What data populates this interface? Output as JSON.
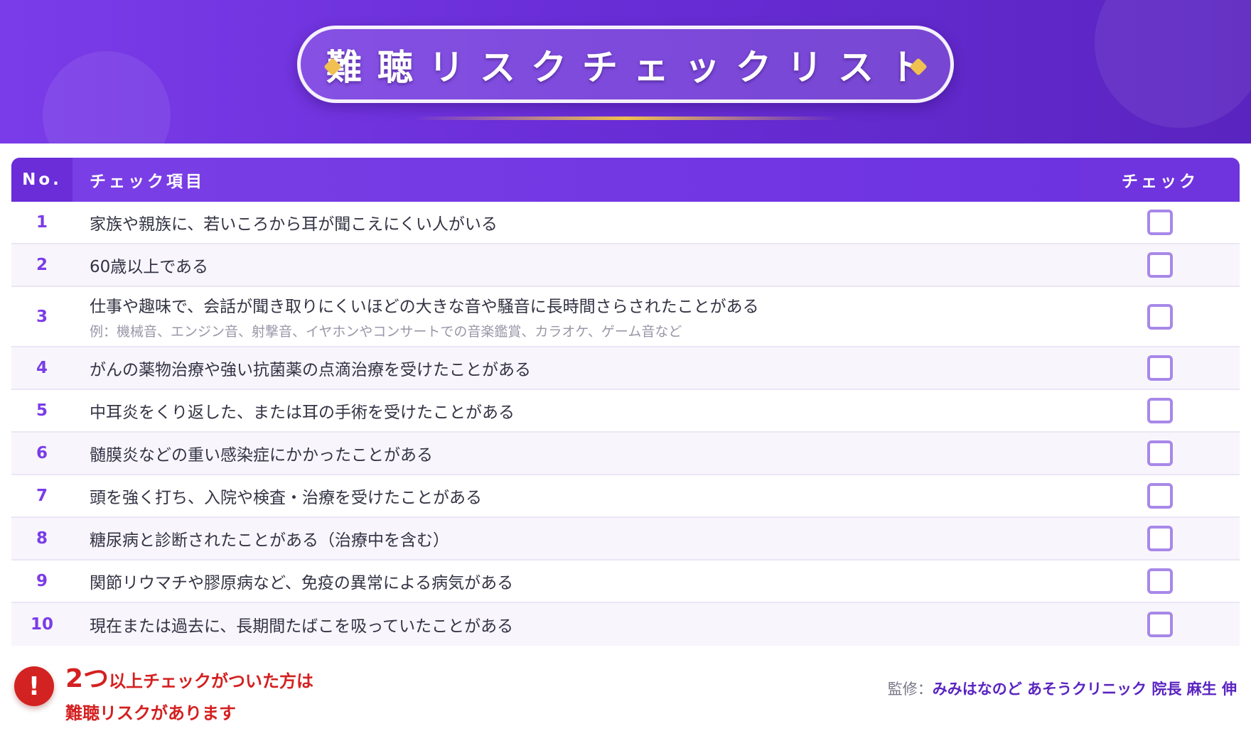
{
  "header": {
    "title": "難聴リスクチェックリスト"
  },
  "table": {
    "columns": {
      "no": "No.",
      "item": "チェック項目",
      "check": "チェック"
    },
    "rows": [
      {
        "no": "1",
        "text": "家族や親族に、若いころから耳が聞こえにくい人がいる",
        "checked": false
      },
      {
        "no": "2",
        "text": "60歳以上である",
        "checked": false
      },
      {
        "no": "3",
        "text": "仕事や趣味で、会話が聞き取りにくいほどの大きな音や騒音に長時間さらされたことがある",
        "note": "例：機械音、エンジン音、射撃音、イヤホンやコンサートでの音楽鑑賞、カラオケ、ゲーム音など",
        "checked": false
      },
      {
        "no": "4",
        "text": "がんの薬物治療や強い抗菌薬の点滴治療を受けたことがある",
        "checked": false
      },
      {
        "no": "5",
        "text": "中耳炎をくり返した、または耳の手術を受けたことがある",
        "checked": false
      },
      {
        "no": "6",
        "text": "髄膜炎などの重い感染症にかかったことがある",
        "checked": false
      },
      {
        "no": "7",
        "text": "頭を強く打ち、入院や検査・治療を受けたことがある",
        "checked": false
      },
      {
        "no": "8",
        "text": "糖尿病と診断されたことがある（治療中を含む）",
        "checked": false
      },
      {
        "no": "9",
        "text": "関節リウマチや膠原病など、免疫の異常による病気がある",
        "checked": false
      },
      {
        "no": "10",
        "text": "現在または過去に、長期間たばこを吸っていたことがある",
        "checked": false
      }
    ]
  },
  "footer": {
    "warning": {
      "icon": "!",
      "count": "2つ",
      "line1_rest": "以上チェックがついた方は",
      "line2": "難聴リスクがあります"
    },
    "supervision": {
      "label": "監修：",
      "name": "みみはなのど あそうクリニック 院長 麻生 伸"
    }
  },
  "colors": {
    "primary": "#7a3ce8",
    "accent_gold": "#f0c050",
    "warning_red": "#d42020"
  }
}
